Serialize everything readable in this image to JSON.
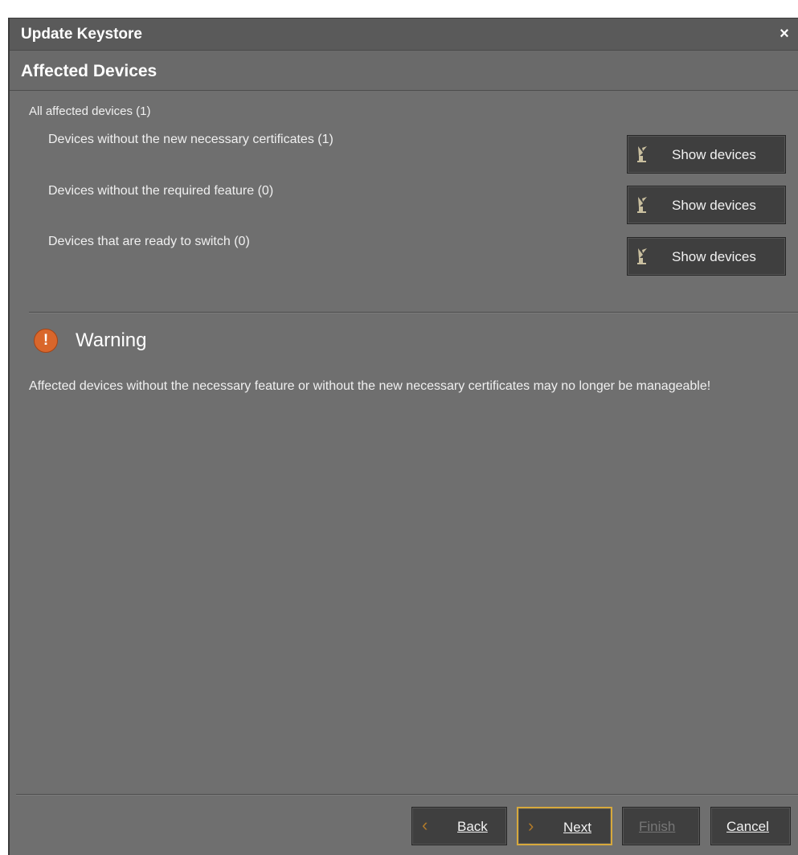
{
  "window": {
    "title": "Update Keystore",
    "close": "×"
  },
  "header": {
    "heading": "Affected Devices"
  },
  "summary": {
    "all_affected": "All affected devices (1)"
  },
  "device_groups": [
    {
      "label": "Devices without the new necessary certificates (1)",
      "button": "Show devices"
    },
    {
      "label": "Devices without the required feature (0)",
      "button": "Show devices"
    },
    {
      "label": "Devices that are ready to switch (0)",
      "button": "Show devices"
    }
  ],
  "warning": {
    "title": "Warning",
    "icon_glyph": "!",
    "text": "Affected devices without the necessary feature or without the new necessary certificates may no longer be manageable!"
  },
  "footer": {
    "back": "Back",
    "next": "Next",
    "finish": "Finish",
    "cancel": "Cancel"
  },
  "icons": {
    "show_devices": "satellite-dish-icon",
    "warning": "warning-icon",
    "back": "chevron-left-icon",
    "next": "chevron-right-icon"
  },
  "colors": {
    "background": "#6f6f6f",
    "titlebar": "#5a5a5a",
    "button": "#3f3f3f",
    "warning_accent": "#d9662b",
    "focus_border": "#d7a93c"
  }
}
